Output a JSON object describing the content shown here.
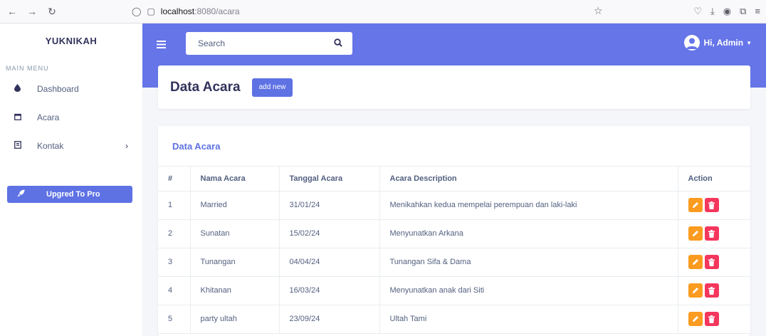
{
  "browser": {
    "url_host": "localhost",
    "url_path": ":8080/acara"
  },
  "sidebar": {
    "brand": "YUKNIKAH",
    "menu_heading": "MAIN MENU",
    "items": [
      {
        "label": "Dashboard",
        "icon": "droplet-icon"
      },
      {
        "label": "Acara",
        "icon": "calendar-icon"
      },
      {
        "label": "Kontak",
        "icon": "contact-book-icon",
        "has_submenu": true
      }
    ],
    "pro_button": "Upgred To Pro"
  },
  "topbar": {
    "search_placeholder": "Search",
    "user_greeting": "Hi, Admin"
  },
  "header": {
    "title": "Data Acara",
    "add_button": "add new"
  },
  "table": {
    "card_title": "Data Acara",
    "columns": [
      "#",
      "Nama Acara",
      "Tanggal Acara",
      "Acara Description",
      "Action"
    ],
    "rows": [
      {
        "no": "1",
        "nama": "Married",
        "tanggal": "31/01/24",
        "desc": "Menikahkan kedua mempelai perempuan dan laki-laki"
      },
      {
        "no": "2",
        "nama": "Sunatan",
        "tanggal": "15/02/24",
        "desc": "Menyunatkan Arkana"
      },
      {
        "no": "3",
        "nama": "Tunangan",
        "tanggal": "04/04/24",
        "desc": "Tunangan Sifa & Dama"
      },
      {
        "no": "4",
        "nama": "Khitanan",
        "tanggal": "16/03/24",
        "desc": "Menyunatkan anak dari Siti"
      },
      {
        "no": "5",
        "nama": "party ultah",
        "tanggal": "23/09/24",
        "desc": "Ultah Tami"
      }
    ]
  },
  "colors": {
    "primary": "#5e72e4",
    "topbar": "#6675e8",
    "edit": "#fb9b1f",
    "delete": "#f5365c"
  }
}
